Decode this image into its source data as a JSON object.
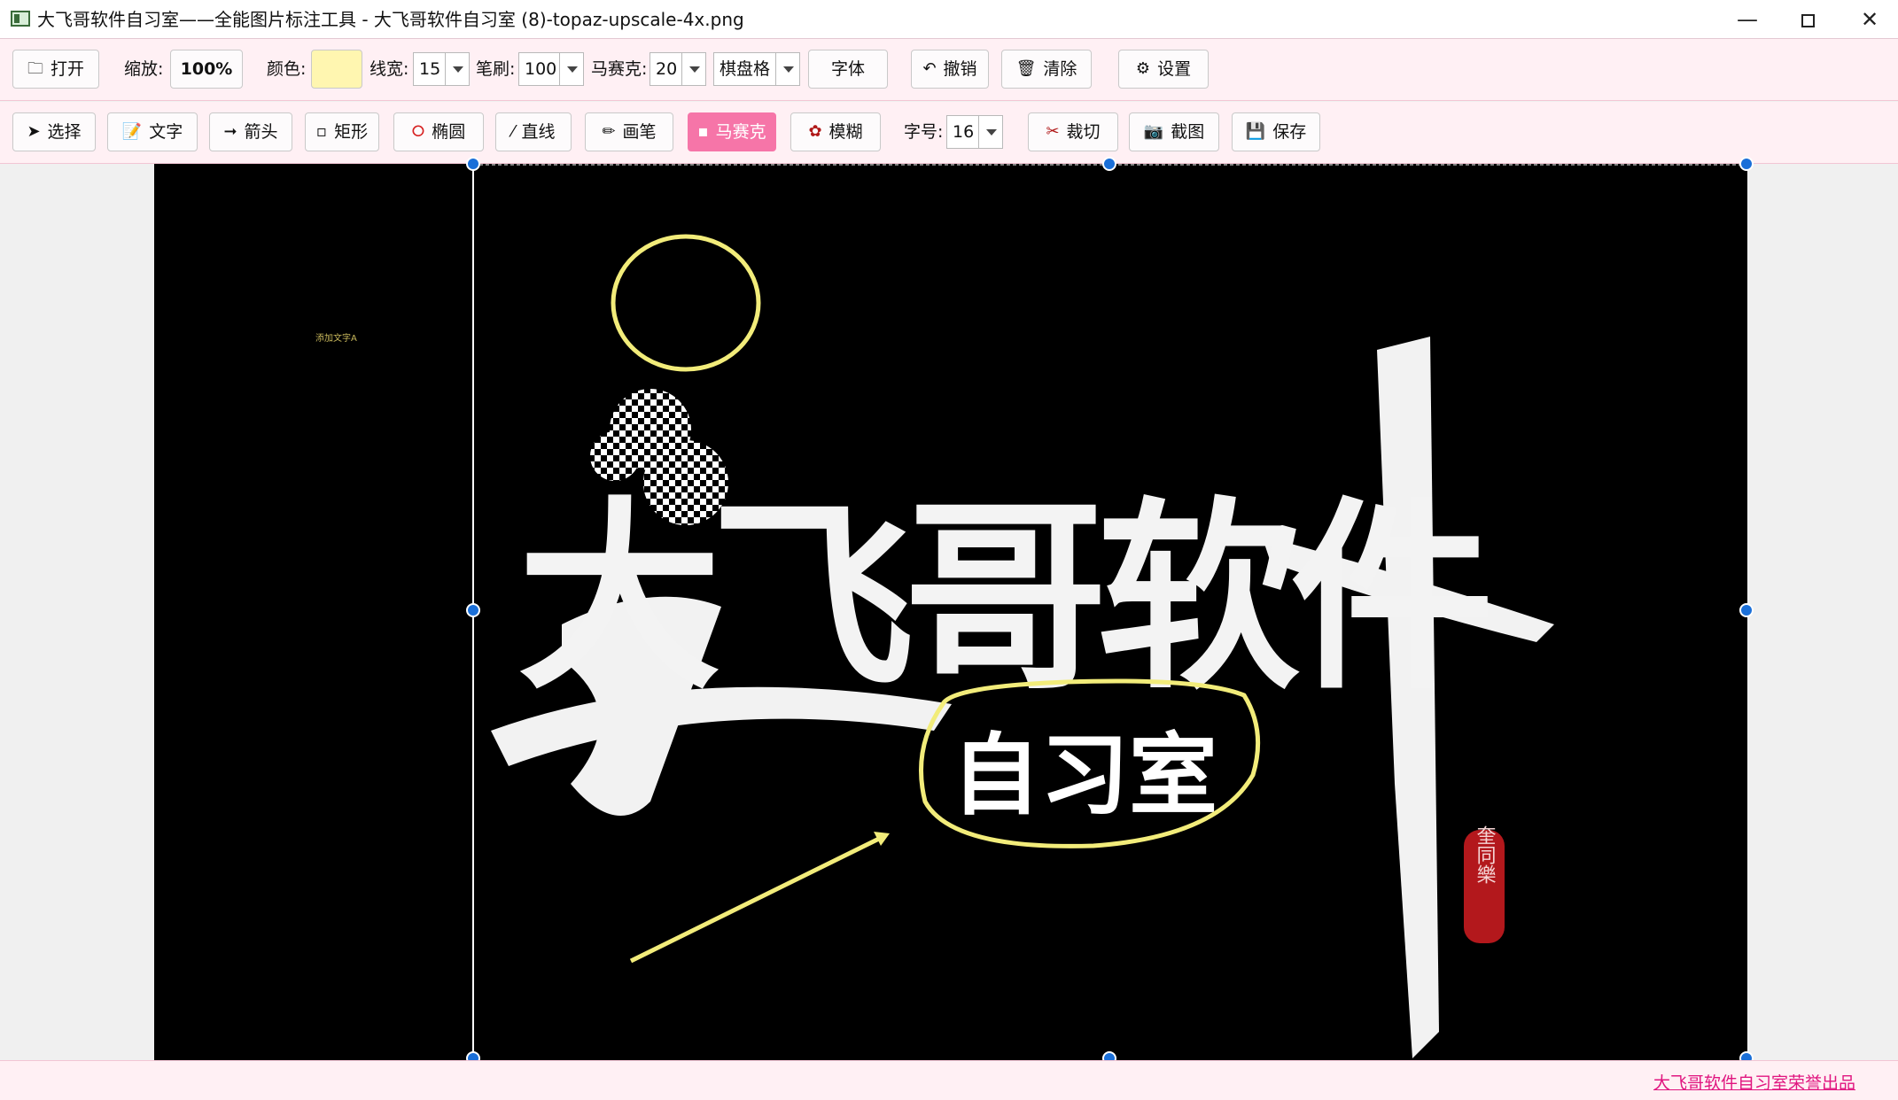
{
  "window": {
    "title": "大飞哥软件自习室——全能图片标注工具 - 大飞哥软件自习室 (8)-topaz-upscale-4x.png",
    "minimize": "—",
    "close": "✕"
  },
  "toolbar1": {
    "open": "打开",
    "zoom_label": "缩放:",
    "zoom_value": "100%",
    "color_label": "颜色:",
    "color_value": "#fff6b0",
    "line_width_label": "线宽:",
    "line_width_value": "15",
    "brush_label": "笔刷:",
    "brush_value": "100",
    "mosaic_label": "马赛克:",
    "mosaic_value": "20",
    "mosaic_style": "棋盘格",
    "font": "字体",
    "undo": "撤销",
    "clear": "清除",
    "settings": "设置"
  },
  "toolbar2": {
    "select": "选择",
    "text": "文字",
    "arrow": "箭头",
    "rect": "矩形",
    "ellipse": "椭圆",
    "line": "直线",
    "pen": "画笔",
    "mosaic": "马赛克",
    "blur": "模糊",
    "font_size_label": "字号:",
    "font_size_value": "16",
    "crop": "裁切",
    "screenshot": "截图",
    "save": "保存"
  },
  "canvas": {
    "small_text": "添加文字A",
    "headline": "大飞哥软件",
    "subtitle": "自习室",
    "seal": "奎同樂",
    "annotation_color": "#f2ec7a",
    "selection_handle_color": "#1a6fd8"
  },
  "footer": {
    "credit": "大飞哥软件自习室荣誉出品"
  }
}
